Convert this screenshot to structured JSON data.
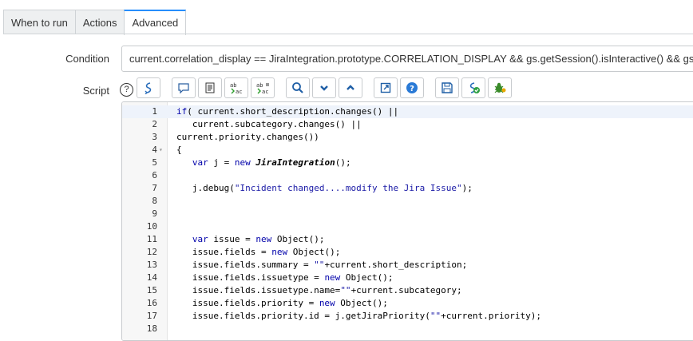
{
  "tabs": [
    {
      "label": "When to run",
      "active": false
    },
    {
      "label": "Actions",
      "active": false
    },
    {
      "label": "Advanced",
      "active": true
    }
  ],
  "condition": {
    "label": "Condition",
    "value": "current.correlation_display == JiraIntegration.prototype.CORRELATION_DISPLAY && gs.getSession().isInteractive()  && gs.getProperty("
  },
  "script": {
    "label": "Script",
    "help_icon": "?",
    "toolbar": [
      "toggle-syntax-icon",
      "comment-icon",
      "format-code-icon",
      "replace-icon",
      "replace-all-icon",
      "search-icon",
      "next-match-icon",
      "previous-match-icon",
      "fullscreen-icon",
      "help-icon",
      "save-icon",
      "script-check-icon",
      "debug-icon"
    ]
  },
  "editor": {
    "lines": [
      {
        "n": "1",
        "code": "if( current.short_description.changes() ||"
      },
      {
        "n": "2",
        "code": "   current.subcategory.changes() ||"
      },
      {
        "n": "3",
        "code": "current.priority.changes())"
      },
      {
        "n": "4",
        "code": "{"
      },
      {
        "n": "5",
        "code": "   var j = new JiraIntegration();"
      },
      {
        "n": "6",
        "code": ""
      },
      {
        "n": "7",
        "code": "   j.debug(\"Incident changed....modify the Jira Issue\");"
      },
      {
        "n": "8",
        "code": ""
      },
      {
        "n": "9",
        "code": ""
      },
      {
        "n": "10",
        "code": ""
      },
      {
        "n": "11",
        "code": "   var issue = new Object();"
      },
      {
        "n": "12",
        "code": "   issue.fields = new Object();"
      },
      {
        "n": "13",
        "code": "   issue.fields.summary = \"\"+current.short_description;"
      },
      {
        "n": "14",
        "code": "   issue.fields.issuetype = new Object();"
      },
      {
        "n": "15",
        "code": "   issue.fields.issuetype.name=\"\"+current.subcategory;"
      },
      {
        "n": "16",
        "code": "   issue.fields.priority = new Object();"
      },
      {
        "n": "17",
        "code": "   issue.fields.priority.id = j.getJiraPriority(\"\"+current.priority);"
      },
      {
        "n": "18",
        "code": ""
      }
    ]
  }
}
